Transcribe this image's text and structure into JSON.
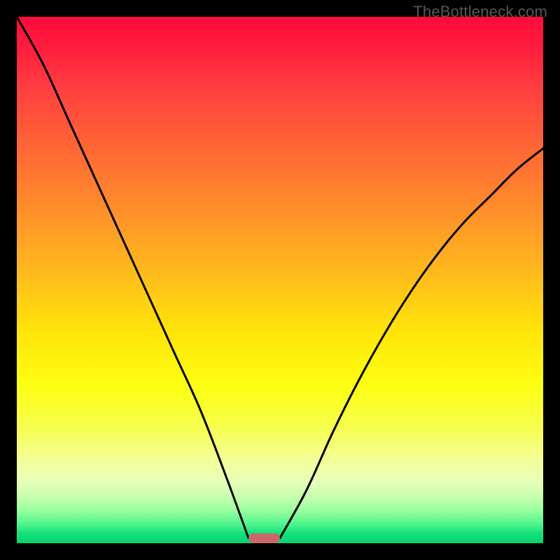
{
  "watermark": "TheBottleneck.com",
  "colors": {
    "frame": "#000000",
    "curve": "#000000",
    "marker": "#ca6869",
    "watermark": "#575757"
  },
  "chart_data": {
    "type": "line",
    "title": "",
    "xlabel": "",
    "ylabel": "",
    "xlim": [
      0,
      100
    ],
    "ylim": [
      0,
      100
    ],
    "grid": false,
    "legend": false,
    "notes": "V-shaped bottleneck curve on rainbow gradient; minimum near x≈47. Left branch starts at y=100 at x=0 and falls to ~0 at x≈44. Right branch rises from ~0 at x≈50 to ~75 at x=100.",
    "series": [
      {
        "name": "bottleneck-curve-left",
        "x": [
          0,
          5,
          10,
          15,
          20,
          25,
          30,
          35,
          40,
          44
        ],
        "values": [
          100,
          91,
          80,
          69,
          58,
          47,
          36,
          25,
          12,
          1
        ]
      },
      {
        "name": "bottleneck-curve-right",
        "x": [
          50,
          55,
          60,
          65,
          70,
          75,
          80,
          85,
          90,
          95,
          100
        ],
        "values": [
          1,
          10,
          21,
          31,
          40,
          48,
          55,
          61,
          66,
          71,
          75
        ]
      }
    ],
    "marker": {
      "x_start": 44,
      "x_end": 50,
      "y": 0
    }
  }
}
